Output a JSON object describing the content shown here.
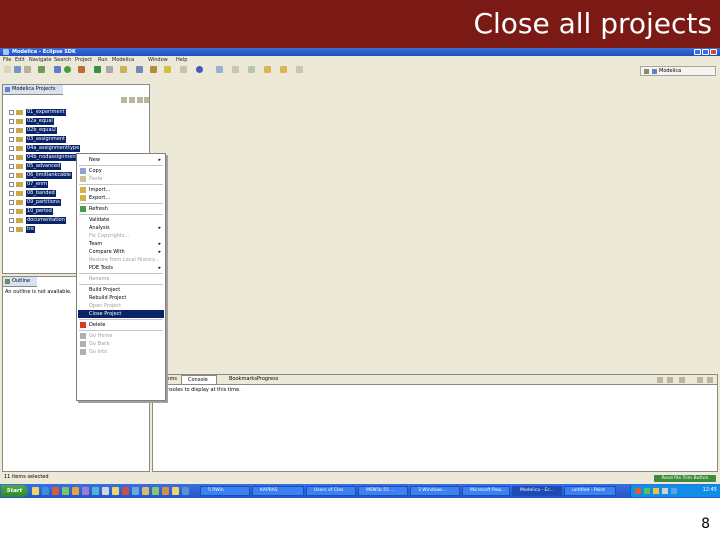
{
  "slide": {
    "title": "Close all projects",
    "page_number": "8"
  },
  "window": {
    "title": "Modelica - Eclipse SDK"
  },
  "menubar": [
    "File",
    "Edit",
    "Navigate",
    "Search",
    "Project",
    "Run",
    "Modelica",
    "Window",
    "Help"
  ],
  "perspective": {
    "label": "Modelica"
  },
  "project_panel": {
    "tab_label": "Modelica Projects",
    "items": [
      "01_experiment",
      "02a_equal",
      "02b_equal2",
      "03_assignment",
      "04a_assignmenttype",
      "04b_nodassignmenttype",
      "05_advanced",
      "06_limitlankcable",
      "07_enm",
      "08_banded",
      "09_partitions",
      "10_period",
      "documentation",
      "tre"
    ]
  },
  "outline_panel": {
    "tab_label": "Outline",
    "message": "An outline is not available."
  },
  "bottom_tabs": {
    "problems": "lems",
    "console": "Console",
    "bookmarks": "Bookmarks",
    "progress": "Progress",
    "console_message": "nsoles to display at this time."
  },
  "context_menu": {
    "items": [
      {
        "label": "New",
        "submenu": true,
        "disabled": false,
        "icon": "none"
      },
      {
        "separator": true
      },
      {
        "label": "Copy",
        "disabled": false,
        "icon": "copy-icon"
      },
      {
        "label": "Paste",
        "disabled": true,
        "icon": "paste-icon"
      },
      {
        "separator": true
      },
      {
        "label": "Import...",
        "disabled": false,
        "icon": "import-icon"
      },
      {
        "label": "Export...",
        "disabled": false,
        "icon": "export-icon"
      },
      {
        "separator": true
      },
      {
        "label": "Refresh",
        "disabled": false,
        "icon": "refresh-icon"
      },
      {
        "separator": true
      },
      {
        "label": "Validate",
        "disabled": false,
        "icon": "none"
      },
      {
        "label": "Analysis",
        "submenu": true,
        "disabled": false,
        "icon": "none"
      },
      {
        "label": "Fix Copyrights...",
        "disabled": true,
        "icon": "none"
      },
      {
        "label": "Team",
        "submenu": true,
        "disabled": false,
        "icon": "none"
      },
      {
        "label": "Compare With",
        "submenu": true,
        "disabled": false,
        "icon": "none"
      },
      {
        "label": "Restore from Local History...",
        "disabled": true,
        "icon": "none"
      },
      {
        "label": "PDE Tools",
        "submenu": true,
        "disabled": false,
        "icon": "none"
      },
      {
        "separator": true
      },
      {
        "label": "Rename",
        "disabled": true,
        "icon": "none"
      },
      {
        "separator": true
      },
      {
        "label": "Build Project",
        "disabled": false,
        "icon": "none"
      },
      {
        "label": "Rebuild Project",
        "disabled": false,
        "icon": "none"
      },
      {
        "label": "Open Project",
        "disabled": true,
        "icon": "none"
      },
      {
        "label": "Close Project",
        "disabled": false,
        "icon": "none",
        "selected": true
      },
      {
        "separator": true
      },
      {
        "label": "Delete",
        "disabled": false,
        "icon": "delete-icon"
      },
      {
        "separator": true
      },
      {
        "label": "Go Home",
        "disabled": true,
        "icon": "home-icon"
      },
      {
        "label": "Go Back",
        "disabled": true,
        "icon": "back-icon"
      },
      {
        "label": "Go Into",
        "disabled": true,
        "icon": "go-into-icon"
      }
    ]
  },
  "statusbar": {
    "text": "11 items selected",
    "trim_button": "Read file Trim Button"
  },
  "taskbar": {
    "start": "Start",
    "tasks": [
      {
        "label": "5 RWin",
        "active": false
      },
      {
        "label": "KAPRAS",
        "active": false
      },
      {
        "label": "Users of Clas",
        "active": false
      },
      {
        "label": "MSN5b 55 ...",
        "active": false
      },
      {
        "label": "3 Windows...",
        "active": false
      },
      {
        "label": "Microsoft Pow...",
        "active": false
      },
      {
        "label": "Modelica - Ec...",
        "active": true
      },
      {
        "label": "untitled - Paint",
        "active": false
      }
    ],
    "clock": "12:45"
  },
  "colors": {
    "banner": "#7b1a14",
    "selection": "#0a246a",
    "taskbar": "#2357c4"
  }
}
